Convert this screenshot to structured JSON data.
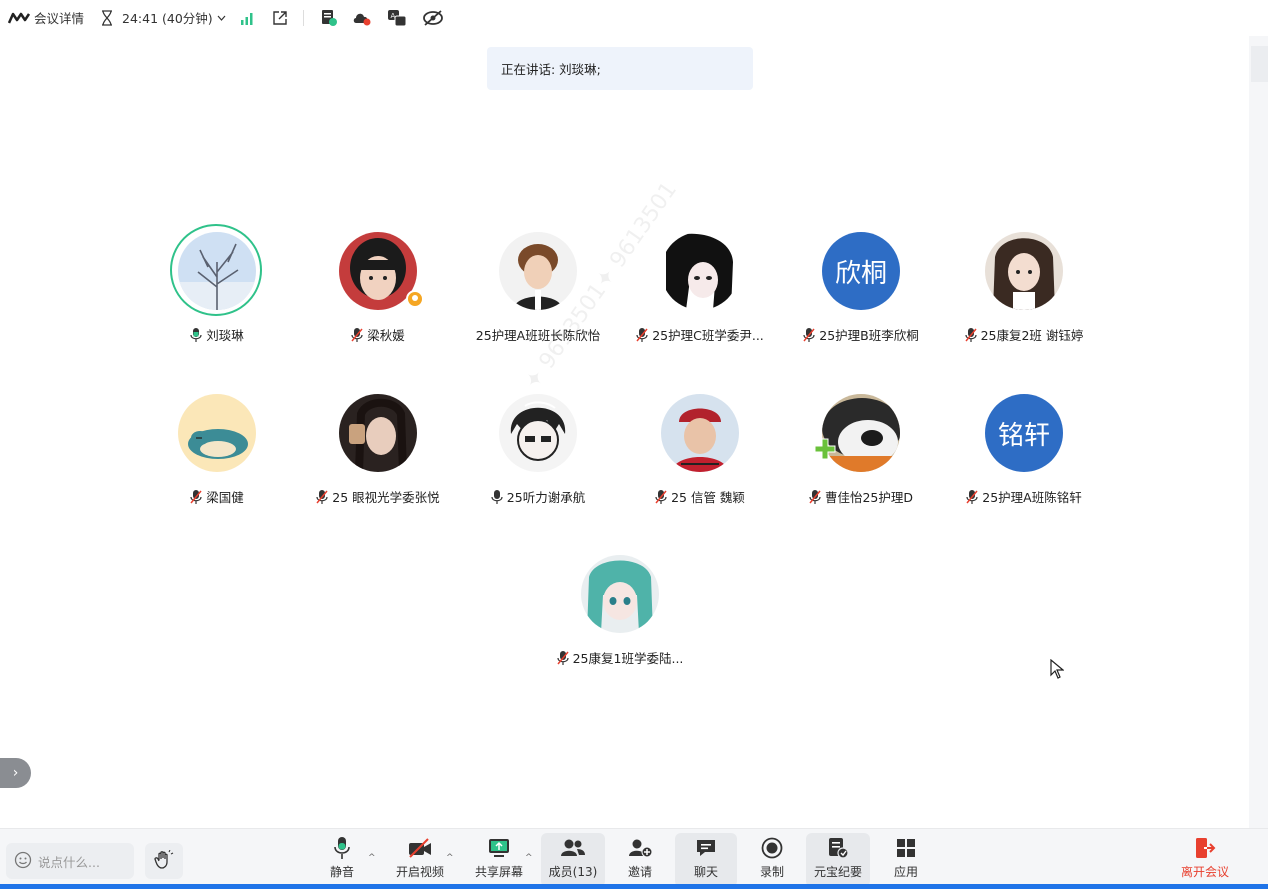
{
  "topbar": {
    "meeting_details": "会议详情",
    "timer": "24:41 (40分钟)"
  },
  "speaker": {
    "text": "正在讲话: 刘琰琳;"
  },
  "participants": [
    {
      "name": "刘琰琳",
      "mic": "speaking"
    },
    {
      "name": "梁秋媛",
      "mic": "muted"
    },
    {
      "name": "25护理A班班长陈欣怡",
      "mic": "none"
    },
    {
      "name": "25护理C班学委尹...",
      "mic": "muted"
    },
    {
      "name": "25护理B班李欣桐",
      "mic": "muted",
      "avatar_text": "欣桐"
    },
    {
      "name": "25康复2班  谢钰婷",
      "mic": "muted"
    },
    {
      "name": "梁国健",
      "mic": "muted"
    },
    {
      "name": "25 眼视光学委张悦",
      "mic": "muted"
    },
    {
      "name": "25听力谢承航",
      "mic": "on"
    },
    {
      "name": "25 信管 魏颖",
      "mic": "muted"
    },
    {
      "name": "曹佳怡25护理D",
      "mic": "muted"
    },
    {
      "name": "25护理A班陈铭轩",
      "mic": "muted",
      "avatar_text": "铭轩"
    },
    {
      "name": "25康复1班学委陆...",
      "mic": "muted"
    }
  ],
  "bottom": {
    "chat_placeholder": "说点什么...",
    "mute": "静音",
    "video": "开启视频",
    "share": "共享屏幕",
    "members": "成员(13)",
    "invite": "邀请",
    "chat": "聊天",
    "record": "录制",
    "notes": "元宝纪要",
    "apps": "应用",
    "leave": "离开会议"
  },
  "colors": {
    "accent": "#1f74e8",
    "speaking_ring": "#2fc28a",
    "avatar_blue": "#2e6dc5",
    "leave_red": "#e8402f"
  }
}
